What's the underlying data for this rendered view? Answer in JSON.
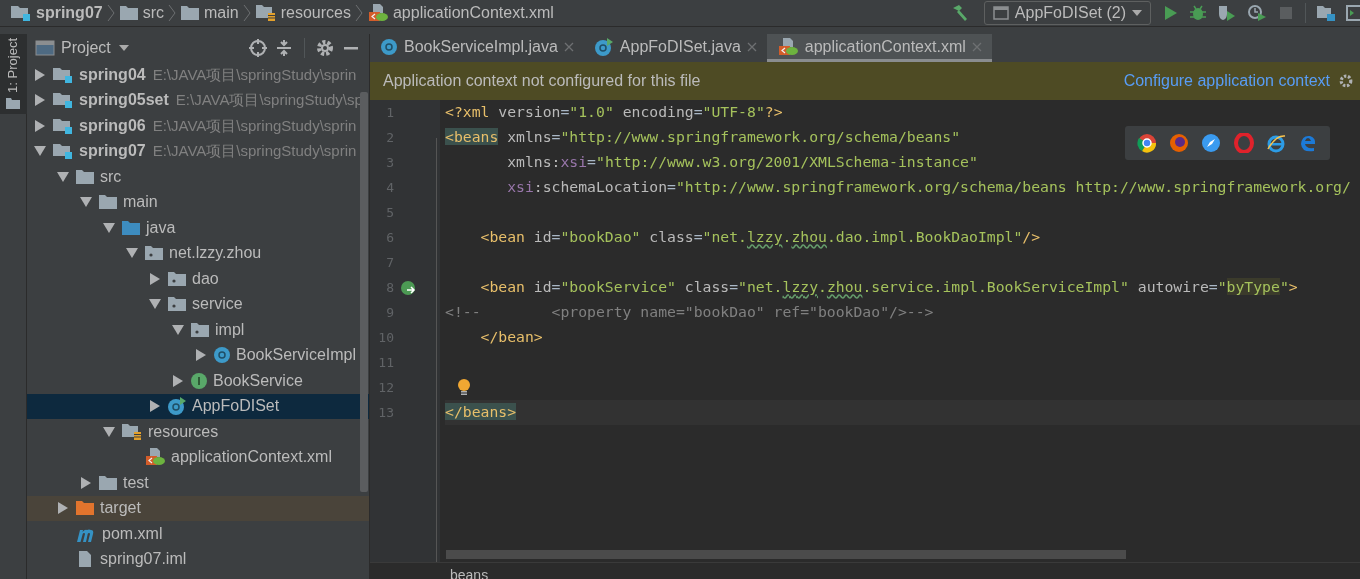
{
  "breadcrumbs": [
    {
      "label": "spring07",
      "kind": "module"
    },
    {
      "label": "src",
      "kind": "folder"
    },
    {
      "label": "main",
      "kind": "folder"
    },
    {
      "label": "resources",
      "kind": "resources"
    },
    {
      "label": "applicationContext.xml",
      "kind": "xml"
    }
  ],
  "run_config": {
    "label": "AppFoDISet (2)"
  },
  "tool_window_tab": {
    "label": "1: Project"
  },
  "project_panel": {
    "title": "Project"
  },
  "tree": [
    {
      "name": "spring04",
      "path": "E:\\JAVA项目\\springStudy\\sprin",
      "kind": "module",
      "expanded": false,
      "selected": false
    },
    {
      "name": "spring05set",
      "path": "E:\\JAVA项目\\springStudy\\sp",
      "kind": "module",
      "expanded": false,
      "selected": false
    },
    {
      "name": "spring06",
      "path": "E:\\JAVA项目\\springStudy\\sprin",
      "kind": "module",
      "expanded": false,
      "selected": false
    },
    {
      "name": "spring07",
      "path": "E:\\JAVA项目\\springStudy\\sprin",
      "kind": "module",
      "expanded": true,
      "selected": false,
      "children": [
        {
          "name": "src",
          "kind": "folder",
          "expanded": true,
          "selected": false,
          "children": [
            {
              "name": "main",
              "kind": "folder",
              "expanded": true,
              "selected": false,
              "children": [
                {
                  "name": "java",
                  "kind": "source",
                  "expanded": true,
                  "selected": false,
                  "children": [
                    {
                      "name": "net.lzzy.zhou",
                      "kind": "package",
                      "expanded": true,
                      "selected": false,
                      "children": [
                        {
                          "name": "dao",
                          "kind": "package",
                          "expanded": false,
                          "selected": false
                        },
                        {
                          "name": "service",
                          "kind": "package",
                          "expanded": true,
                          "selected": false,
                          "children": [
                            {
                              "name": "impl",
                              "kind": "package",
                              "expanded": true,
                              "selected": false,
                              "children": [
                                {
                                  "name": "BookServiceImpl",
                                  "kind": "class",
                                  "expanded": false,
                                  "selected": false
                                }
                              ]
                            },
                            {
                              "name": "BookService",
                              "kind": "interface",
                              "expanded": false,
                              "selected": false
                            }
                          ]
                        },
                        {
                          "name": "AppFoDISet",
                          "kind": "app",
                          "expanded": false,
                          "selected": true
                        }
                      ]
                    }
                  ]
                },
                {
                  "name": "resources",
                  "kind": "resources",
                  "expanded": true,
                  "selected": false,
                  "children": [
                    {
                      "name": "applicationContext.xml",
                      "kind": "xml",
                      "selected": false
                    }
                  ]
                }
              ]
            },
            {
              "name": "test",
              "kind": "folder",
              "expanded": false,
              "selected": false
            }
          ]
        },
        {
          "name": "target",
          "kind": "excluded",
          "expanded": false,
          "selected": false
        },
        {
          "name": "pom.xml",
          "kind": "pom",
          "selected": false
        },
        {
          "name": "spring07.iml",
          "kind": "iml",
          "selected": false
        }
      ]
    }
  ],
  "tabs": [
    {
      "label": "BookServiceImpl.java",
      "kind": "class",
      "selected": false
    },
    {
      "label": "AppFoDISet.java",
      "kind": "app",
      "selected": false
    },
    {
      "label": "applicationContext.xml",
      "kind": "xml",
      "selected": true
    }
  ],
  "banner": {
    "message": "Application context not configured for this file",
    "action": "Configure application context"
  },
  "code": [
    {
      "number": "1",
      "kind": "plain",
      "tokens": [
        {
          "kind": "tag",
          "text": "<?xml "
        },
        {
          "kind": "attr",
          "text": "version"
        },
        {
          "kind": "plain",
          "text": "="
        },
        {
          "kind": "value",
          "text": "\"1.0\" "
        },
        {
          "kind": "attr",
          "text": "encoding"
        },
        {
          "kind": "plain",
          "text": "="
        },
        {
          "kind": "value",
          "text": "\"UTF-8\""
        },
        {
          "kind": "tag",
          "text": "?>"
        }
      ]
    },
    {
      "number": "2",
      "kind": "plain",
      "tokens": [
        {
          "kind": "tag_match",
          "text": "<beans"
        },
        {
          "kind": "attr",
          "text": " xmlns"
        },
        {
          "kind": "plain",
          "text": "="
        },
        {
          "kind": "value",
          "text": "\"http://www.springframework.org/schema/beans\""
        }
      ]
    },
    {
      "number": "3",
      "kind": "plain",
      "tokens": [
        {
          "kind": "attr",
          "text": "       xmlns:"
        },
        {
          "kind": "ns",
          "text": "xsi"
        },
        {
          "kind": "plain",
          "text": "="
        },
        {
          "kind": "value",
          "text": "\"http://www.w3.org/2001/XMLSchema-instance\""
        }
      ]
    },
    {
      "number": "4",
      "kind": "plain",
      "tokens": [
        {
          "kind": "ns",
          "text": "       xsi"
        },
        {
          "kind": "attr",
          "text": ":schemaLocation"
        },
        {
          "kind": "plain",
          "text": "="
        },
        {
          "kind": "value",
          "text": "\"http://www.springframework.org/schema/beans http://www.springframework.org/"
        }
      ]
    },
    {
      "number": "5",
      "kind": "plain"
    },
    {
      "number": "6",
      "kind": "plain",
      "tokens": [
        {
          "kind": "tag",
          "text": "    <bean "
        },
        {
          "kind": "attr",
          "text": "id"
        },
        {
          "kind": "plain",
          "text": "="
        },
        {
          "kind": "value",
          "text": "\"bookDao\" "
        },
        {
          "kind": "attr",
          "text": "class"
        },
        {
          "kind": "plain",
          "text": "="
        },
        {
          "kind": "value",
          "text": "\"net."
        },
        {
          "kind": "typo",
          "text": "lzzy"
        },
        {
          "kind": "value",
          "text": "."
        },
        {
          "kind": "typo",
          "text": "zhou"
        },
        {
          "kind": "value",
          "text": ".dao.impl.BookDaoImpl\""
        },
        {
          "kind": "tag",
          "text": "/>"
        }
      ]
    },
    {
      "number": "7",
      "kind": "plain"
    },
    {
      "number": "8",
      "kind": "bean",
      "tokens": [
        {
          "kind": "tag",
          "text": "    <bean "
        },
        {
          "kind": "attr",
          "text": "id"
        },
        {
          "kind": "plain",
          "text": "="
        },
        {
          "kind": "value",
          "text": "\"bookService\" "
        },
        {
          "kind": "attr",
          "text": "class"
        },
        {
          "kind": "plain",
          "text": "="
        },
        {
          "kind": "value",
          "text": "\"net."
        },
        {
          "kind": "typo",
          "text": "lzzy"
        },
        {
          "kind": "value",
          "text": "."
        },
        {
          "kind": "typo",
          "text": "zhou"
        },
        {
          "kind": "value",
          "text": ".service.impl.BookServiceImpl\" "
        },
        {
          "kind": "attr",
          "text": "autowire"
        },
        {
          "kind": "plain",
          "text": "="
        },
        {
          "kind": "value",
          "text": "\""
        },
        {
          "kind": "value_match",
          "text": "byType"
        },
        {
          "kind": "value",
          "text": "\""
        },
        {
          "kind": "tag",
          "text": ">"
        }
      ]
    },
    {
      "number": "9",
      "kind": "plain",
      "tokens": [
        {
          "kind": "comment",
          "text": "<!--        <property name=\"bookDao\" ref=\"bookDao\"/>-->"
        }
      ]
    },
    {
      "number": "10",
      "kind": "plain",
      "tokens": [
        {
          "kind": "tag",
          "text": "    </bean>"
        }
      ]
    },
    {
      "number": "11",
      "kind": "plain"
    },
    {
      "number": "12",
      "kind": "bulb"
    },
    {
      "number": "13",
      "kind": "plain",
      "current": true,
      "tokens": [
        {
          "kind": "tag_match",
          "text": "</beans>"
        }
      ]
    }
  ],
  "status_crumb": "beans"
}
